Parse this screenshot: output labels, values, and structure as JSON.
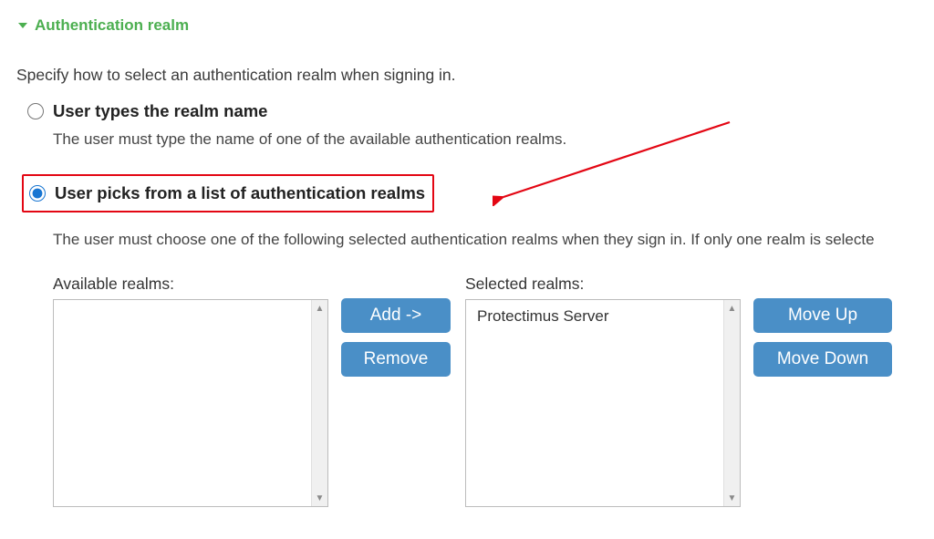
{
  "section": {
    "title": "Authentication realm"
  },
  "intro": "Specify how to select an authentication realm when signing in.",
  "options": {
    "types": {
      "label": "User types the realm name",
      "desc": "The user must type the name of one of the available authentication realms."
    },
    "picks": {
      "label": "User picks from a list of authentication realms",
      "desc": "The user must choose one of the following selected authentication realms when they sign in. If only one realm is selecte"
    }
  },
  "panels": {
    "available_label": "Available realms:",
    "selected_label": "Selected realms:"
  },
  "selected_items": [
    "Protectimus Server"
  ],
  "buttons": {
    "add": "Add ->",
    "remove": "Remove",
    "move_up": "Move Up",
    "move_down": "Move Down"
  }
}
